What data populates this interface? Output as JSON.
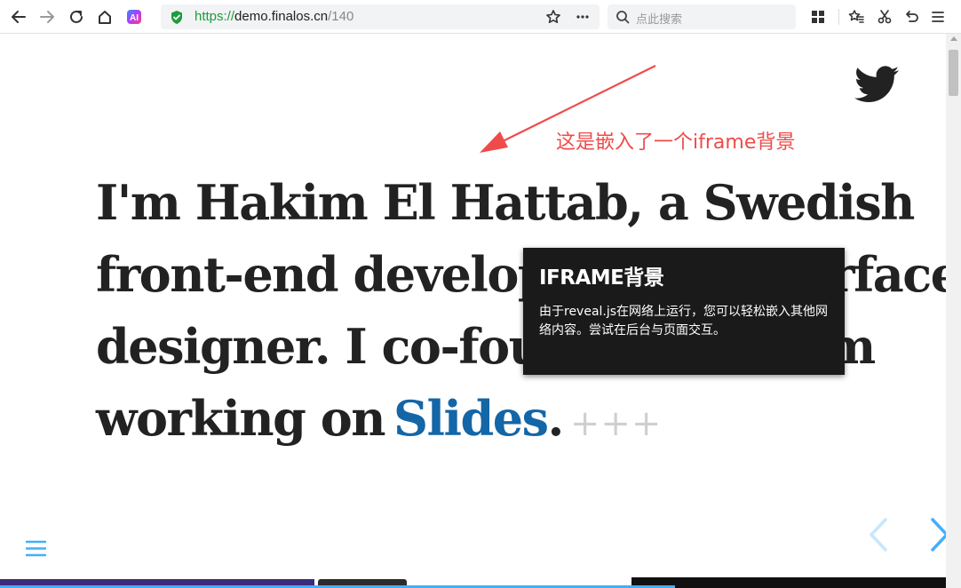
{
  "browser": {
    "url": {
      "scheme": "https://",
      "host": "demo.finalos.cn",
      "path": "/140"
    },
    "search": {
      "placeholder": "点此搜索"
    }
  },
  "slide": {
    "headline_lines": [
      "I'm Hakim El Hattab, a Swedish",
      "front-end developer and interface",
      "designer. I co-founded and am",
      "working on"
    ],
    "link_text": "Slides",
    "period": ".",
    "plus": "+++"
  },
  "annotation": {
    "text": "这是嵌入了一个iframe背景"
  },
  "tooltip": {
    "title": "IFRAME背景",
    "body": "由于reveal.js在网络上运行，您可以轻松嵌入其他网络内容。尝试在后台与页面交互。"
  },
  "colors": {
    "annotation": "#ef4b4b",
    "link": "#1466a6",
    "twitter": "#222222",
    "nav_arrow": "#42affa"
  },
  "icons": [
    "back-icon",
    "forward-icon",
    "reload-icon",
    "home-icon",
    "ai-icon",
    "shield-icon",
    "star-icon",
    "more-icon",
    "search-icon",
    "apps-icon",
    "favorites-icon",
    "scissors-icon",
    "undo-icon",
    "menu-icon",
    "twitter-icon",
    "hamburger-icon",
    "prev-arrow-icon",
    "next-arrow-icon"
  ]
}
